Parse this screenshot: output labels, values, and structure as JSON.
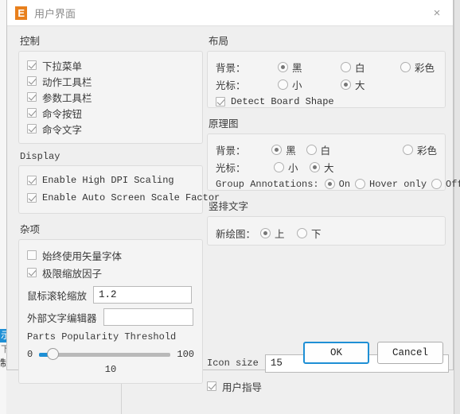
{
  "window": {
    "title": "用户界面",
    "logo_letter": "E",
    "close_icon": "×"
  },
  "background": {
    "selected_text": "示",
    "text_row2": "下",
    "text_row3": "制"
  },
  "left": {
    "control": {
      "title": "控制",
      "items": [
        {
          "label": "下拉菜单",
          "checked": true
        },
        {
          "label": "动作工具栏",
          "checked": true
        },
        {
          "label": "参数工具栏",
          "checked": true
        },
        {
          "label": "命令按钮",
          "checked": true
        },
        {
          "label": "命令文字",
          "checked": true
        }
      ]
    },
    "display": {
      "title": "Display",
      "items": [
        {
          "label": "Enable High DPI Scaling",
          "checked": true
        },
        {
          "label": "Enable Auto Screen Scale Factor",
          "checked": true
        }
      ]
    },
    "misc": {
      "title": "杂项",
      "items": [
        {
          "label": "始终使用矢量字体",
          "checked": false
        },
        {
          "label": "极限缩放因子",
          "checked": true
        }
      ],
      "zoom_label": "鼠标滚轮缩放",
      "zoom_value": "1.2",
      "editor_label": "外部文字编辑器",
      "editor_value": "",
      "editor_placeholder": "",
      "threshold_label": "Parts Popularity Threshold",
      "threshold_min": "0",
      "threshold_max": "100",
      "threshold_value": "10"
    }
  },
  "right": {
    "layout": {
      "title": "布局",
      "background_label": "背景：",
      "background_options": [
        "黑",
        "白",
        "彩色"
      ],
      "background_selected": "黑",
      "cursor_label": "光标：",
      "cursor_options": [
        "小",
        "大"
      ],
      "cursor_selected": "大",
      "detect_label": "Detect Board Shape",
      "detect_checked": true
    },
    "schematic": {
      "title": "原理图",
      "background_label": "背景：",
      "background_options": [
        "黑",
        "白",
        "彩色"
      ],
      "background_selected": "黑",
      "cursor_label": "光标：",
      "cursor_options": [
        "小",
        "大"
      ],
      "cursor_selected": "大",
      "annotations_label": "Group Annotations:",
      "annotations_options": [
        "On",
        "Hover only",
        "Off"
      ],
      "annotations_selected": "On"
    },
    "vertical_text": {
      "title": "竖排文字",
      "new_draw_label": "新绘图：",
      "options": [
        "上",
        "下"
      ],
      "selected": "上"
    },
    "icon_size_label": "Icon size",
    "icon_size_value": "15",
    "user_guide_label": "用户指导",
    "user_guide_checked": true
  },
  "footer": {
    "ok_label": "OK",
    "cancel_label": "Cancel"
  },
  "colors": {
    "accent": "#1e8fd5",
    "logo": "#e8801d"
  }
}
